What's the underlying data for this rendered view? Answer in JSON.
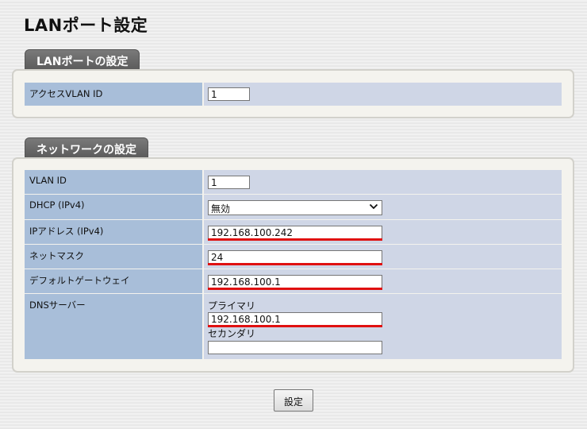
{
  "page": {
    "title": "LANポート設定"
  },
  "lan_section": {
    "tab_label": "LANポートの設定",
    "rows": [
      {
        "label": "アクセスVLAN ID",
        "value": "1"
      }
    ]
  },
  "network_section": {
    "tab_label": "ネットワークの設定",
    "vlan_id": {
      "label": "VLAN ID",
      "value": "1"
    },
    "dhcp": {
      "label": "DHCP (IPv4)",
      "selected": "無効"
    },
    "ip_address": {
      "label": "IPアドレス (IPv4)",
      "value": "192.168.100.242"
    },
    "netmask": {
      "label": "ネットマスク",
      "value": "24"
    },
    "gateway": {
      "label": "デフォルトゲートウェイ",
      "value": "192.168.100.1"
    },
    "dns": {
      "label": "DNSサーバー",
      "primary_label": "プライマリ",
      "primary_value": "192.168.100.1",
      "secondary_label": "セカンダリ",
      "secondary_value": ""
    }
  },
  "actions": {
    "submit_label": "設定"
  },
  "colors": {
    "label_bg": "#a8bed9",
    "value_bg": "#cfd6e6",
    "highlight": "#e01010",
    "tab_bg": "#666666"
  },
  "icons": {
    "dropdown": "chevron-down-icon"
  }
}
